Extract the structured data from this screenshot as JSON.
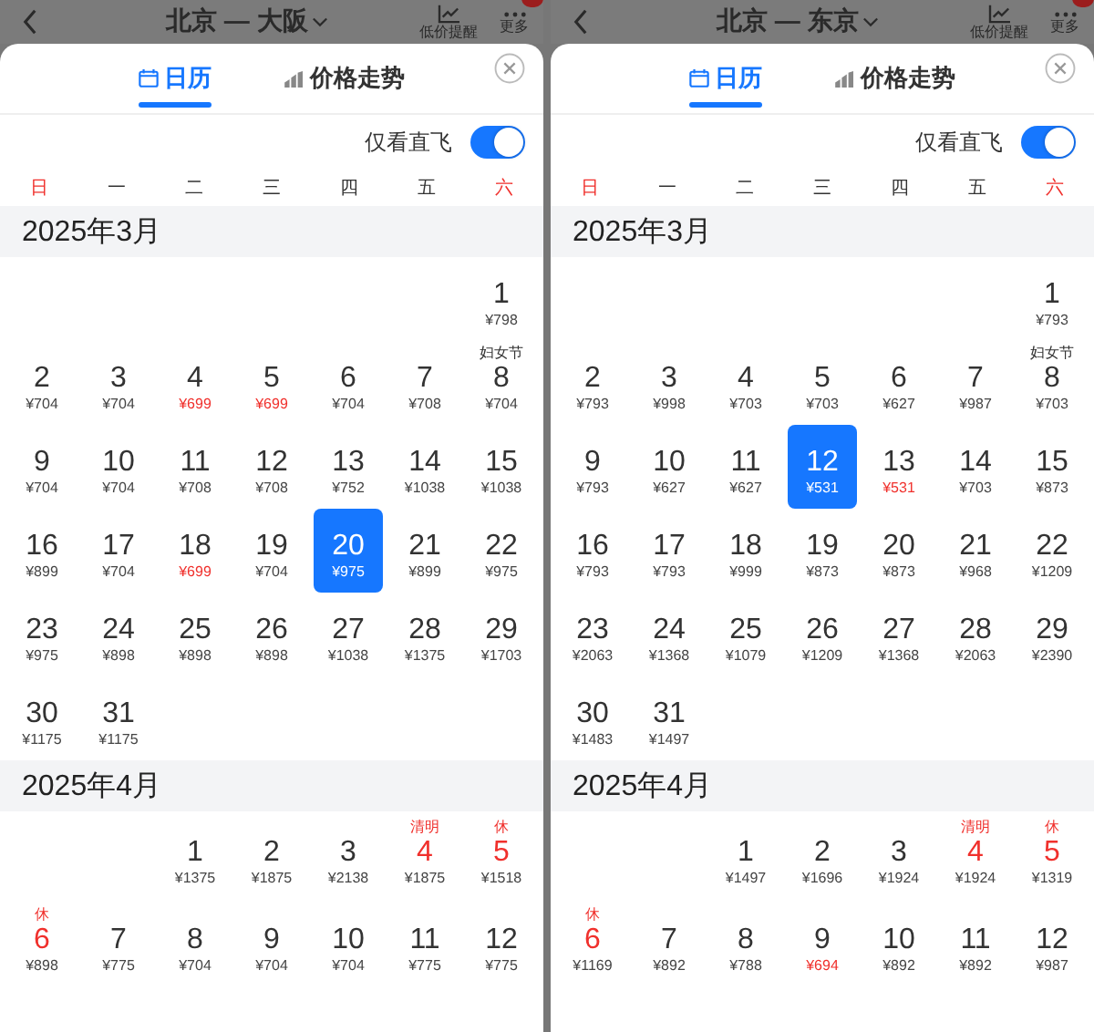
{
  "panels": [
    {
      "header": {
        "title": "北京 — 大阪",
        "alert_label": "低价提醒",
        "more_label": "更多"
      },
      "tabs": [
        {
          "label": "日历",
          "kind": "calendar",
          "selected": true
        },
        {
          "label": "价格走势",
          "kind": "trend",
          "selected": false
        }
      ],
      "direct_only": {
        "label": "仅看直飞",
        "on": true
      },
      "weekdays": [
        {
          "label": "日",
          "weekend": true
        },
        {
          "label": "一",
          "weekend": false
        },
        {
          "label": "二",
          "weekend": false
        },
        {
          "label": "三",
          "weekend": false
        },
        {
          "label": "四",
          "weekend": false
        },
        {
          "label": "五",
          "weekend": false
        },
        {
          "label": "六",
          "weekend": true
        }
      ],
      "months": [
        {
          "title": "2025年3月",
          "days": [
            {
              "kind": "blank"
            },
            {
              "kind": "blank"
            },
            {
              "kind": "blank"
            },
            {
              "kind": "blank"
            },
            {
              "kind": "blank"
            },
            {
              "kind": "blank"
            },
            {
              "kind": "day",
              "day": "1",
              "price": "¥798",
              "low": false,
              "holiday": false,
              "selected": false
            },
            {
              "kind": "day",
              "day": "2",
              "price": "¥704",
              "low": false,
              "holiday": false,
              "selected": false
            },
            {
              "kind": "day",
              "day": "3",
              "price": "¥704",
              "low": false,
              "holiday": false,
              "selected": false
            },
            {
              "kind": "day",
              "day": "4",
              "price": "¥699",
              "low": true,
              "holiday": false,
              "selected": false
            },
            {
              "kind": "day",
              "day": "5",
              "price": "¥699",
              "low": true,
              "holiday": false,
              "selected": false
            },
            {
              "kind": "day",
              "day": "6",
              "price": "¥704",
              "low": false,
              "holiday": false,
              "selected": false
            },
            {
              "kind": "day",
              "day": "7",
              "price": "¥708",
              "low": false,
              "holiday": false,
              "selected": false
            },
            {
              "kind": "day",
              "day": "8",
              "price": "¥704",
              "low": false,
              "holiday": false,
              "selected": false,
              "note": "妇女节"
            },
            {
              "kind": "day",
              "day": "9",
              "price": "¥704",
              "low": false,
              "holiday": false,
              "selected": false
            },
            {
              "kind": "day",
              "day": "10",
              "price": "¥704",
              "low": false,
              "holiday": false,
              "selected": false
            },
            {
              "kind": "day",
              "day": "11",
              "price": "¥708",
              "low": false,
              "holiday": false,
              "selected": false
            },
            {
              "kind": "day",
              "day": "12",
              "price": "¥708",
              "low": false,
              "holiday": false,
              "selected": false
            },
            {
              "kind": "day",
              "day": "13",
              "price": "¥752",
              "low": false,
              "holiday": false,
              "selected": false
            },
            {
              "kind": "day",
              "day": "14",
              "price": "¥1038",
              "low": false,
              "holiday": false,
              "selected": false
            },
            {
              "kind": "day",
              "day": "15",
              "price": "¥1038",
              "low": false,
              "holiday": false,
              "selected": false
            },
            {
              "kind": "day",
              "day": "16",
              "price": "¥899",
              "low": false,
              "holiday": false,
              "selected": false
            },
            {
              "kind": "day",
              "day": "17",
              "price": "¥704",
              "low": false,
              "holiday": false,
              "selected": false
            },
            {
              "kind": "day",
              "day": "18",
              "price": "¥699",
              "low": true,
              "holiday": false,
              "selected": false
            },
            {
              "kind": "day",
              "day": "19",
              "price": "¥704",
              "low": false,
              "holiday": false,
              "selected": false
            },
            {
              "kind": "day",
              "day": "20",
              "price": "¥975",
              "low": false,
              "holiday": false,
              "selected": true
            },
            {
              "kind": "day",
              "day": "21",
              "price": "¥899",
              "low": false,
              "holiday": false,
              "selected": false
            },
            {
              "kind": "day",
              "day": "22",
              "price": "¥975",
              "low": false,
              "holiday": false,
              "selected": false
            },
            {
              "kind": "day",
              "day": "23",
              "price": "¥975",
              "low": false,
              "holiday": false,
              "selected": false
            },
            {
              "kind": "day",
              "day": "24",
              "price": "¥898",
              "low": false,
              "holiday": false,
              "selected": false
            },
            {
              "kind": "day",
              "day": "25",
              "price": "¥898",
              "low": false,
              "holiday": false,
              "selected": false
            },
            {
              "kind": "day",
              "day": "26",
              "price": "¥898",
              "low": false,
              "holiday": false,
              "selected": false
            },
            {
              "kind": "day",
              "day": "27",
              "price": "¥1038",
              "low": false,
              "holiday": false,
              "selected": false
            },
            {
              "kind": "day",
              "day": "28",
              "price": "¥1375",
              "low": false,
              "holiday": false,
              "selected": false
            },
            {
              "kind": "day",
              "day": "29",
              "price": "¥1703",
              "low": false,
              "holiday": false,
              "selected": false
            },
            {
              "kind": "day",
              "day": "30",
              "price": "¥1175",
              "low": false,
              "holiday": false,
              "selected": false
            },
            {
              "kind": "day",
              "day": "31",
              "price": "¥1175",
              "low": false,
              "holiday": false,
              "selected": false
            }
          ]
        },
        {
          "title": "2025年4月",
          "days": [
            {
              "kind": "blank"
            },
            {
              "kind": "blank"
            },
            {
              "kind": "day",
              "day": "1",
              "price": "¥1375",
              "low": false,
              "holiday": false,
              "selected": false
            },
            {
              "kind": "day",
              "day": "2",
              "price": "¥1875",
              "low": false,
              "holiday": false,
              "selected": false
            },
            {
              "kind": "day",
              "day": "3",
              "price": "¥2138",
              "low": false,
              "holiday": false,
              "selected": false
            },
            {
              "kind": "day",
              "day": "4",
              "price": "¥1875",
              "low": false,
              "holiday": true,
              "selected": false,
              "note": "清明"
            },
            {
              "kind": "day",
              "day": "5",
              "price": "¥1518",
              "low": false,
              "holiday": true,
              "selected": false,
              "note": "休"
            },
            {
              "kind": "day",
              "day": "6",
              "price": "¥898",
              "low": false,
              "holiday": true,
              "selected": false,
              "note": "休"
            },
            {
              "kind": "day",
              "day": "7",
              "price": "¥775",
              "low": false,
              "holiday": false,
              "selected": false
            },
            {
              "kind": "day",
              "day": "8",
              "price": "¥704",
              "low": false,
              "holiday": false,
              "selected": false
            },
            {
              "kind": "day",
              "day": "9",
              "price": "¥704",
              "low": false,
              "holiday": false,
              "selected": false
            },
            {
              "kind": "day",
              "day": "10",
              "price": "¥704",
              "low": false,
              "holiday": false,
              "selected": false
            },
            {
              "kind": "day",
              "day": "11",
              "price": "¥775",
              "low": false,
              "holiday": false,
              "selected": false
            },
            {
              "kind": "day",
              "day": "12",
              "price": "¥775",
              "low": false,
              "holiday": false,
              "selected": false
            }
          ]
        }
      ]
    },
    {
      "header": {
        "title": "北京 — 东京",
        "alert_label": "低价提醒",
        "more_label": "更多"
      },
      "tabs": [
        {
          "label": "日历",
          "kind": "calendar",
          "selected": true
        },
        {
          "label": "价格走势",
          "kind": "trend",
          "selected": false
        }
      ],
      "direct_only": {
        "label": "仅看直飞",
        "on": true
      },
      "weekdays": [
        {
          "label": "日",
          "weekend": true
        },
        {
          "label": "一",
          "weekend": false
        },
        {
          "label": "二",
          "weekend": false
        },
        {
          "label": "三",
          "weekend": false
        },
        {
          "label": "四",
          "weekend": false
        },
        {
          "label": "五",
          "weekend": false
        },
        {
          "label": "六",
          "weekend": true
        }
      ],
      "months": [
        {
          "title": "2025年3月",
          "days": [
            {
              "kind": "blank"
            },
            {
              "kind": "blank"
            },
            {
              "kind": "blank"
            },
            {
              "kind": "blank"
            },
            {
              "kind": "blank"
            },
            {
              "kind": "blank"
            },
            {
              "kind": "day",
              "day": "1",
              "price": "¥793",
              "low": false,
              "holiday": false,
              "selected": false
            },
            {
              "kind": "day",
              "day": "2",
              "price": "¥793",
              "low": false,
              "holiday": false,
              "selected": false
            },
            {
              "kind": "day",
              "day": "3",
              "price": "¥998",
              "low": false,
              "holiday": false,
              "selected": false
            },
            {
              "kind": "day",
              "day": "4",
              "price": "¥703",
              "low": false,
              "holiday": false,
              "selected": false
            },
            {
              "kind": "day",
              "day": "5",
              "price": "¥703",
              "low": false,
              "holiday": false,
              "selected": false
            },
            {
              "kind": "day",
              "day": "6",
              "price": "¥627",
              "low": false,
              "holiday": false,
              "selected": false
            },
            {
              "kind": "day",
              "day": "7",
              "price": "¥987",
              "low": false,
              "holiday": false,
              "selected": false
            },
            {
              "kind": "day",
              "day": "8",
              "price": "¥703",
              "low": false,
              "holiday": false,
              "selected": false,
              "note": "妇女节"
            },
            {
              "kind": "day",
              "day": "9",
              "price": "¥793",
              "low": false,
              "holiday": false,
              "selected": false
            },
            {
              "kind": "day",
              "day": "10",
              "price": "¥627",
              "low": false,
              "holiday": false,
              "selected": false
            },
            {
              "kind": "day",
              "day": "11",
              "price": "¥627",
              "low": false,
              "holiday": false,
              "selected": false
            },
            {
              "kind": "day",
              "day": "12",
              "price": "¥531",
              "low": false,
              "holiday": false,
              "selected": true
            },
            {
              "kind": "day",
              "day": "13",
              "price": "¥531",
              "low": true,
              "holiday": false,
              "selected": false
            },
            {
              "kind": "day",
              "day": "14",
              "price": "¥703",
              "low": false,
              "holiday": false,
              "selected": false
            },
            {
              "kind": "day",
              "day": "15",
              "price": "¥873",
              "low": false,
              "holiday": false,
              "selected": false
            },
            {
              "kind": "day",
              "day": "16",
              "price": "¥793",
              "low": false,
              "holiday": false,
              "selected": false
            },
            {
              "kind": "day",
              "day": "17",
              "price": "¥793",
              "low": false,
              "holiday": false,
              "selected": false
            },
            {
              "kind": "day",
              "day": "18",
              "price": "¥999",
              "low": false,
              "holiday": false,
              "selected": false
            },
            {
              "kind": "day",
              "day": "19",
              "price": "¥873",
              "low": false,
              "holiday": false,
              "selected": false
            },
            {
              "kind": "day",
              "day": "20",
              "price": "¥873",
              "low": false,
              "holiday": false,
              "selected": false
            },
            {
              "kind": "day",
              "day": "21",
              "price": "¥968",
              "low": false,
              "holiday": false,
              "selected": false
            },
            {
              "kind": "day",
              "day": "22",
              "price": "¥1209",
              "low": false,
              "holiday": false,
              "selected": false
            },
            {
              "kind": "day",
              "day": "23",
              "price": "¥2063",
              "low": false,
              "holiday": false,
              "selected": false
            },
            {
              "kind": "day",
              "day": "24",
              "price": "¥1368",
              "low": false,
              "holiday": false,
              "selected": false
            },
            {
              "kind": "day",
              "day": "25",
              "price": "¥1079",
              "low": false,
              "holiday": false,
              "selected": false
            },
            {
              "kind": "day",
              "day": "26",
              "price": "¥1209",
              "low": false,
              "holiday": false,
              "selected": false
            },
            {
              "kind": "day",
              "day": "27",
              "price": "¥1368",
              "low": false,
              "holiday": false,
              "selected": false
            },
            {
              "kind": "day",
              "day": "28",
              "price": "¥2063",
              "low": false,
              "holiday": false,
              "selected": false
            },
            {
              "kind": "day",
              "day": "29",
              "price": "¥2390",
              "low": false,
              "holiday": false,
              "selected": false
            },
            {
              "kind": "day",
              "day": "30",
              "price": "¥1483",
              "low": false,
              "holiday": false,
              "selected": false
            },
            {
              "kind": "day",
              "day": "31",
              "price": "¥1497",
              "low": false,
              "holiday": false,
              "selected": false
            }
          ]
        },
        {
          "title": "2025年4月",
          "days": [
            {
              "kind": "blank"
            },
            {
              "kind": "blank"
            },
            {
              "kind": "day",
              "day": "1",
              "price": "¥1497",
              "low": false,
              "holiday": false,
              "selected": false
            },
            {
              "kind": "day",
              "day": "2",
              "price": "¥1696",
              "low": false,
              "holiday": false,
              "selected": false
            },
            {
              "kind": "day",
              "day": "3",
              "price": "¥1924",
              "low": false,
              "holiday": false,
              "selected": false
            },
            {
              "kind": "day",
              "day": "4",
              "price": "¥1924",
              "low": false,
              "holiday": true,
              "selected": false,
              "note": "清明"
            },
            {
              "kind": "day",
              "day": "5",
              "price": "¥1319",
              "low": false,
              "holiday": true,
              "selected": false,
              "note": "休"
            },
            {
              "kind": "day",
              "day": "6",
              "price": "¥1169",
              "low": false,
              "holiday": true,
              "selected": false,
              "note": "休"
            },
            {
              "kind": "day",
              "day": "7",
              "price": "¥892",
              "low": false,
              "holiday": false,
              "selected": false
            },
            {
              "kind": "day",
              "day": "8",
              "price": "¥788",
              "low": false,
              "holiday": false,
              "selected": false
            },
            {
              "kind": "day",
              "day": "9",
              "price": "¥694",
              "low": true,
              "holiday": false,
              "selected": false
            },
            {
              "kind": "day",
              "day": "10",
              "price": "¥892",
              "low": false,
              "holiday": false,
              "selected": false
            },
            {
              "kind": "day",
              "day": "11",
              "price": "¥892",
              "low": false,
              "holiday": false,
              "selected": false
            },
            {
              "kind": "day",
              "day": "12",
              "price": "¥987",
              "low": false,
              "holiday": false,
              "selected": false
            }
          ]
        }
      ]
    }
  ]
}
